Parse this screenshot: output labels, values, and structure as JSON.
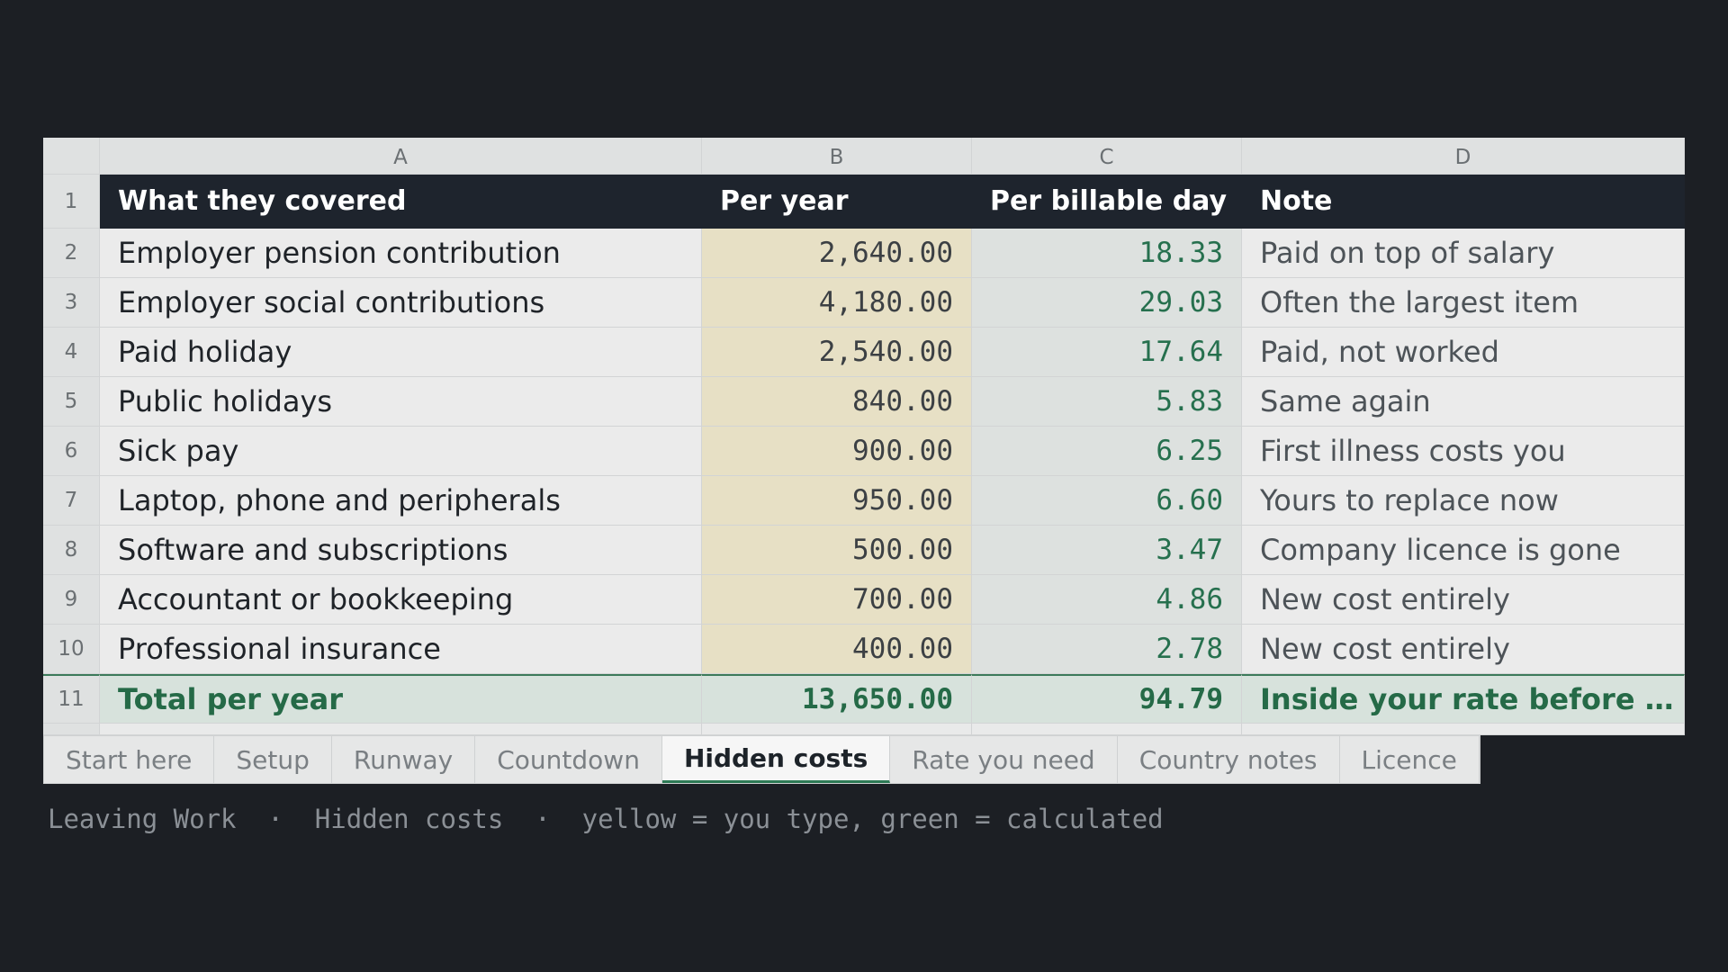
{
  "columns": [
    "A",
    "B",
    "C",
    "D"
  ],
  "header": {
    "row": "1",
    "a": "What they covered",
    "b": "Per year",
    "c": "Per billable day",
    "d": "Note"
  },
  "rows": [
    {
      "n": "2",
      "a": "Employer pension contribution",
      "b": "2,640.00",
      "c": "18.33",
      "d": "Paid on top of salary"
    },
    {
      "n": "3",
      "a": "Employer social contributions",
      "b": "4,180.00",
      "c": "29.03",
      "d": "Often the largest item"
    },
    {
      "n": "4",
      "a": "Paid holiday",
      "b": "2,540.00",
      "c": "17.64",
      "d": "Paid, not worked"
    },
    {
      "n": "5",
      "a": "Public holidays",
      "b": "840.00",
      "c": "5.83",
      "d": "Same again"
    },
    {
      "n": "6",
      "a": "Sick pay",
      "b": "900.00",
      "c": "6.25",
      "d": "First illness costs you"
    },
    {
      "n": "7",
      "a": "Laptop, phone and peripherals",
      "b": "950.00",
      "c": "6.60",
      "d": "Yours to replace now"
    },
    {
      "n": "8",
      "a": "Software and subscriptions",
      "b": "500.00",
      "c": "3.47",
      "d": "Company licence is gone"
    },
    {
      "n": "9",
      "a": "Accountant or bookkeeping",
      "b": "700.00",
      "c": "4.86",
      "d": "New cost entirely"
    },
    {
      "n": "10",
      "a": "Professional insurance",
      "b": "400.00",
      "c": "2.78",
      "d": "New cost entirely"
    }
  ],
  "total": {
    "n": "11",
    "a": "Total per year",
    "b": "13,650.00",
    "c": "94.79",
    "d": "Inside your rate before yo..."
  },
  "tabs": [
    {
      "label": "Start here",
      "active": false
    },
    {
      "label": "Setup",
      "active": false
    },
    {
      "label": "Runway",
      "active": false
    },
    {
      "label": "Countdown",
      "active": false
    },
    {
      "label": "Hidden costs",
      "active": true
    },
    {
      "label": "Rate you need",
      "active": false
    },
    {
      "label": "Country notes",
      "active": false
    },
    {
      "label": "Licence",
      "active": false
    }
  ],
  "footer": "Leaving Work  ·  Hidden costs  ·  yellow = you type, green = calculated",
  "colors": {
    "background": "#1c1f24",
    "header_bg": "#1e242d",
    "input_cell": "#e7e0c5",
    "calc_text": "#26704e",
    "total_bg": "#d7e2dc"
  }
}
